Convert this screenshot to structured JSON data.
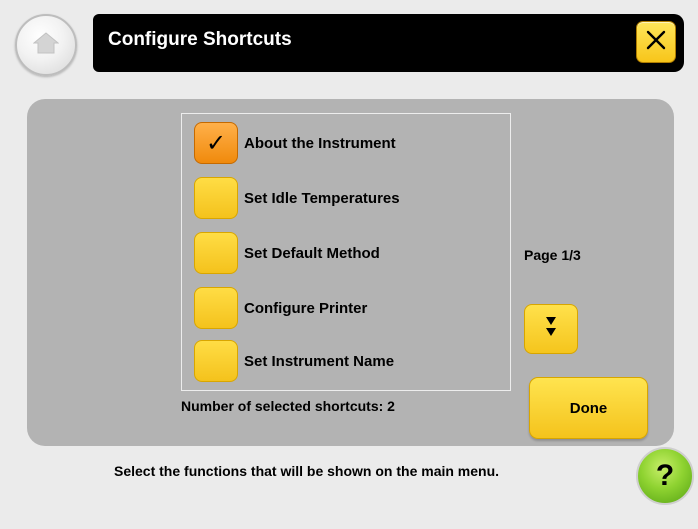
{
  "header": {
    "title": "Configure Shortcuts",
    "home_icon": "home-icon",
    "close_icon": "close-icon"
  },
  "shortcuts": {
    "items": [
      {
        "label": "About the Instrument",
        "checked": true
      },
      {
        "label": "Set Idle Temperatures",
        "checked": false
      },
      {
        "label": "Set Default Method",
        "checked": false
      },
      {
        "label": "Configure Printer",
        "checked": false
      },
      {
        "label": "Set Instrument Name",
        "checked": false
      }
    ],
    "check_glyph": "✓",
    "selected_count_text": "Number of selected shortcuts: 2"
  },
  "pager": {
    "page_text": "Page 1/3",
    "next_icon": "page-down-icon"
  },
  "done_label": "Done",
  "status_text": "Select the functions that will be shown on the main menu.",
  "help": {
    "label": "?"
  },
  "colors": {
    "button_yellow": "#f7c820",
    "checked_orange": "#f49a1f",
    "panel_gray": "#b3b3b3",
    "background": "#ebebeb",
    "titlebar": "#000000",
    "help_green": "#8fd331"
  }
}
